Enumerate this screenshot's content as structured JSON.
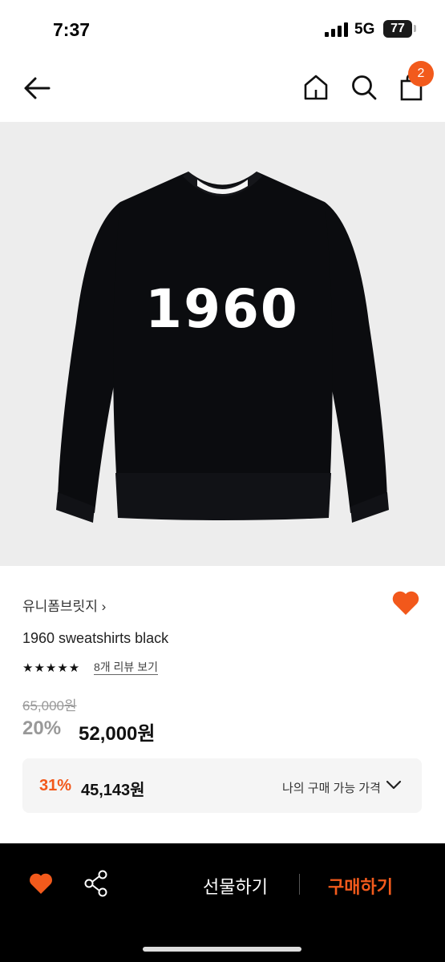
{
  "status": {
    "time": "7:37",
    "network": "5G",
    "battery": "77"
  },
  "nav": {
    "cart_count": "2"
  },
  "product": {
    "brand": "유니폼브릿지 ›",
    "name": "1960 sweatshirts black",
    "stars": "★★★★★",
    "review_link": "8개 리뷰 보기",
    "original_price": "65,000원",
    "discount": "20%",
    "sale_price": "52,000원",
    "image_print": "1960",
    "garment_color": "#0b0c0f"
  },
  "my_price": {
    "discount": "31%",
    "price": "45,143원",
    "label": "나의 구매 가능 가격"
  },
  "bottom_bar": {
    "gift_label": "선물하기",
    "buy_label": "구매하기"
  },
  "colors": {
    "accent": "#f25a1c",
    "favorite": "#f2581b"
  }
}
